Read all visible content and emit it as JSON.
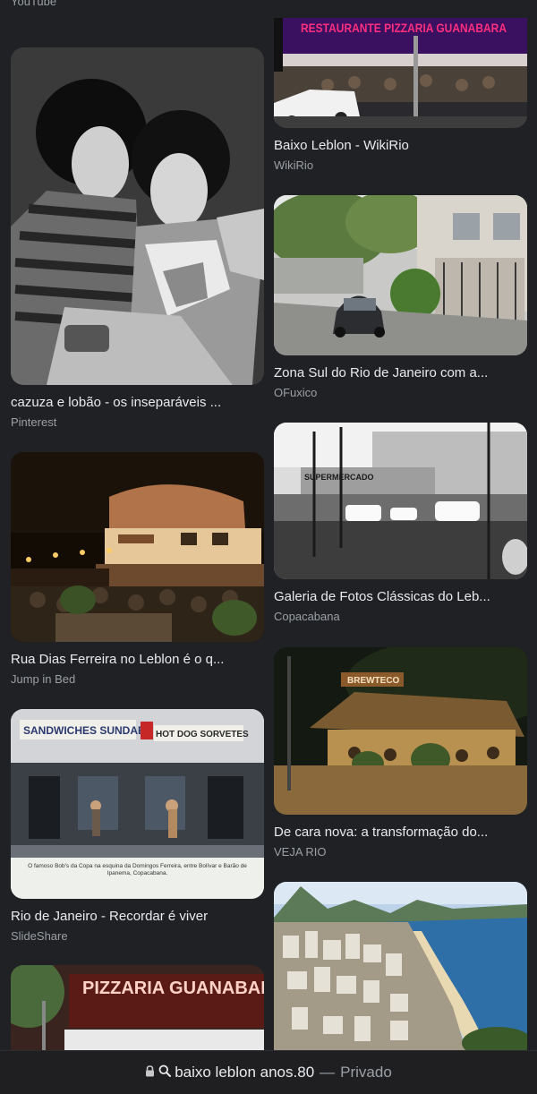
{
  "top_source": "YouTube",
  "results": {
    "left": [
      {
        "title": "cazuza e lobão - os inseparáveis ...",
        "source": "Pinterest"
      },
      {
        "title": "Rua Dias Ferreira no Leblon é o q...",
        "source": "Jump in Bed"
      },
      {
        "title": "Rio de Janeiro - Recordar é viver",
        "source": "SlideShare"
      },
      {
        "title": "",
        "source": ""
      }
    ],
    "right": [
      {
        "title": "Baixo Leblon - WikiRio",
        "source": "WikiRio"
      },
      {
        "title": "Zona Sul do Rio de Janeiro com a...",
        "source": "OFuxico"
      },
      {
        "title": "Galeria de Fotos Clássicas do Leb...",
        "source": "Copacabana"
      },
      {
        "title": "De cara nova: a transformação do...",
        "source": "VEJA RIO"
      }
    ]
  },
  "image_text": {
    "pizzaria_sign": "RESTAURANTE PIZZARIA GUANABARA",
    "supermercado": "SUPERMERCADO",
    "brewteco": "BREWTECO",
    "sandwiches": "SANDWICHES SUNDAES",
    "hotdog": "HOT DOG SORVETES",
    "caption": "O famoso Bob's da Copa na esquina da Domingos Ferreira, entre Bolívar e Barão de Ipanema, Copacabana.",
    "pizzaria_bottom": "PIZZARIA GUANABARA"
  },
  "bottom_bar": {
    "query": "baixo leblon anos.80",
    "separator": "—",
    "mode": "Privado",
    "icons": [
      "lock-icon",
      "search-icon"
    ]
  }
}
